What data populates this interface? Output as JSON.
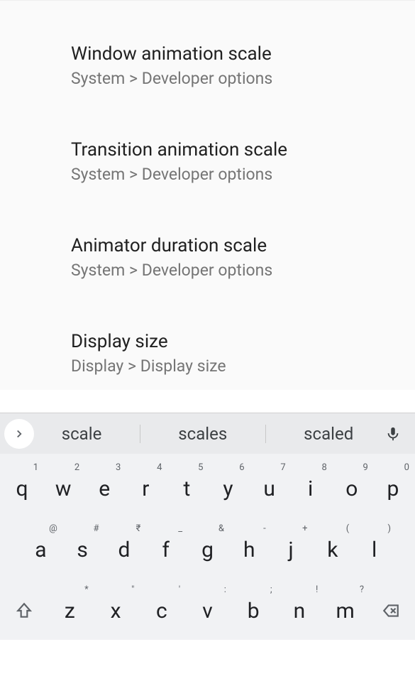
{
  "search_results": [
    {
      "title": "Window animation scale",
      "subtitle": "System > Developer options"
    },
    {
      "title": "Transition animation scale",
      "subtitle": "System > Developer options"
    },
    {
      "title": "Animator duration scale",
      "subtitle": "System > Developer options"
    },
    {
      "title": "Display size",
      "subtitle": "Display > Display size"
    }
  ],
  "suggestions": [
    "scale",
    "scales",
    "scaled"
  ],
  "keyboard": {
    "row1": [
      {
        "main": "q",
        "super": "1"
      },
      {
        "main": "w",
        "super": "2"
      },
      {
        "main": "e",
        "super": "3"
      },
      {
        "main": "r",
        "super": "4"
      },
      {
        "main": "t",
        "super": "5"
      },
      {
        "main": "y",
        "super": "6"
      },
      {
        "main": "u",
        "super": "7"
      },
      {
        "main": "i",
        "super": "8"
      },
      {
        "main": "o",
        "super": "9"
      },
      {
        "main": "p",
        "super": "0"
      }
    ],
    "row2": [
      {
        "main": "a",
        "super": "@"
      },
      {
        "main": "s",
        "super": "#"
      },
      {
        "main": "d",
        "super": "₹"
      },
      {
        "main": "f",
        "super": "_"
      },
      {
        "main": "g",
        "super": "&"
      },
      {
        "main": "h",
        "super": "-"
      },
      {
        "main": "j",
        "super": "+"
      },
      {
        "main": "k",
        "super": "("
      },
      {
        "main": "l",
        "super": ")"
      }
    ],
    "row3": [
      {
        "main": "z",
        "super": "*"
      },
      {
        "main": "x",
        "super": "\""
      },
      {
        "main": "c",
        "super": "'"
      },
      {
        "main": "v",
        "super": ":"
      },
      {
        "main": "b",
        "super": ";"
      },
      {
        "main": "n",
        "super": "!"
      },
      {
        "main": "m",
        "super": "?"
      }
    ]
  }
}
